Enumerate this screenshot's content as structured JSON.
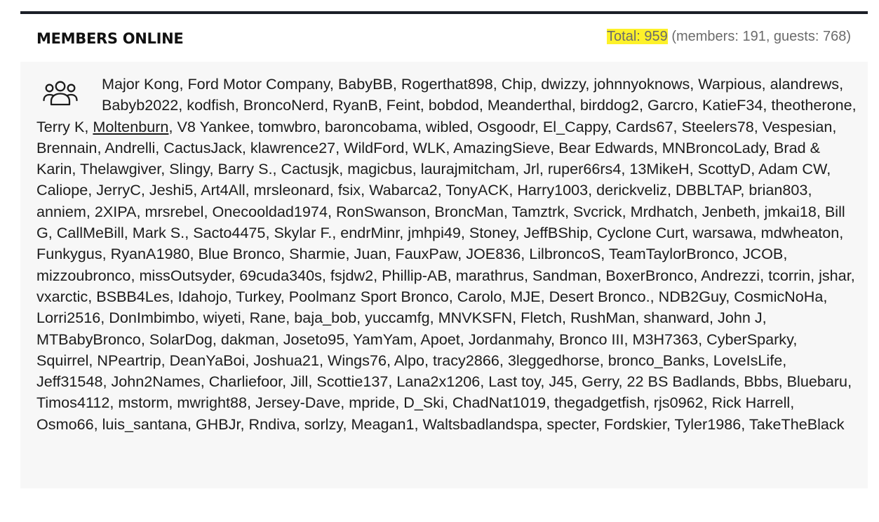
{
  "title": "MEMBERS ONLINE",
  "totals": {
    "total_label": "Total: 959",
    "breakdown": " (members: 191, guests: 768)",
    "total_count": 959,
    "members_count": 191,
    "guests_count": 768,
    "highlight_color": "#fdf12a"
  },
  "icon": "users-group-icon",
  "members": [
    "Major Kong",
    "Ford Motor Company",
    "BabyBB",
    "Rogerthat898",
    "Chip",
    "dwizzy",
    "johnnyoknows",
    "Warpious",
    "alandrews",
    "Babyb2022",
    "kodfish",
    "BroncoNerd",
    "RyanB",
    "Feint",
    "bobdod",
    "Meanderthal",
    "birddog2",
    "Garcro",
    "KatieF34",
    "theotherone",
    "Terry K",
    "Moltenburn",
    "V8 Yankee",
    "tomwbro",
    "baroncobama",
    "wibled",
    "Osgoodr",
    "El_Cappy",
    "Cards67",
    "Steelers78",
    "Vespesian",
    "Brennain",
    "Andrelli",
    "CactusJack",
    "klawrence27",
    "WildFord",
    "WLK",
    "AmazingSieve",
    "Bear Edwards",
    "MNBroncoLady",
    "Brad & Karin",
    "Thelawgiver",
    "Slingy",
    "Barry S.",
    "Cactusjk",
    "magicbus",
    "laurajmitcham",
    "Jrl",
    "ruper66rs4",
    "13MikeH",
    "ScottyD",
    "Adam CW",
    "Caliope",
    "JerryC",
    "Jeshi5",
    "Art4All",
    "mrsleonard",
    "fsix",
    "Wabarca2",
    "TonyACK",
    "Harry1003",
    "derickveliz",
    "DBBLTAP",
    "brian803",
    "anniem",
    "2XIPA",
    "mrsrebel",
    "Onecooldad1974",
    "RonSwanson",
    "BroncMan",
    "Tamztrk",
    "Svcrick",
    "Mrdhatch",
    "Jenbeth",
    "jmkai18",
    "Bill G",
    "CallMeBill",
    "Mark S.",
    "Sacto4475",
    "Skylar F.",
    "endrMinr",
    "jmhpi49",
    "Stoney",
    "JeffBShip",
    "Cyclone Curt",
    "warsawa",
    "mdwheaton",
    "Funkygus",
    "RyanA1980",
    "Blue Bronco",
    "Sharmie",
    "Juan",
    "FauxPaw",
    "JOE836",
    "LilbroncoS",
    "TeamTaylorBronco",
    "JCOB",
    "mizzoubronco",
    "missOutsyder",
    "69cuda340s",
    "fsjdw2",
    "Phillip-AB",
    "marathrus",
    "Sandman",
    "BoxerBronco",
    "Andrezzi",
    "tcorrin",
    "jshar",
    "vxarctic",
    "BSBB4Les",
    "Idahojo",
    "Turkey",
    "Poolmanz Sport Bronco",
    "Carolo",
    "MJE",
    "Desert Bronco.",
    "NDB2Guy",
    "CosmicNoHa",
    "Lorri2516",
    "DonImbimbo",
    "wiyeti",
    "Rane",
    "baja_bob",
    "yuccamfg",
    "MNVKSFN",
    "Fletch",
    "RushMan",
    "shanward",
    "John J",
    "MTBabyBronco",
    "SolarDog",
    "dakman",
    "Joseto95",
    "YamYam",
    "Apoet",
    "Jordanmahy",
    "Bronco III",
    "M3H7363",
    "CyberSparky",
    "Squirrel",
    "NPeartrip",
    "DeanYaBoi",
    "Joshua21",
    "Wings76",
    "Alpo",
    "tracy2866",
    "3leggedhorse",
    "bronco_Banks",
    "LoveIsLife",
    "Jeff31548",
    "John2Names",
    "Charliefoor",
    "Jill",
    "Scottie137",
    "Lana2x1206",
    "Last toy",
    "J45",
    "Gerry",
    "22 BS Badlands",
    "Bbbs",
    "Bluebaru",
    "Timos4112",
    "mstorm",
    "mwright88",
    "Jersey-Dave",
    "mpride",
    "D_Ski",
    "ChadNat1019",
    "thegadgetfish",
    "rjs0962",
    "Rick Harrell",
    "Osmo66",
    "luis_santana",
    "GHBJr",
    "Rndiva",
    "sorlzy",
    "Meagan1",
    "Waltsbadlandspa",
    "specter",
    "Fordskier",
    "Tyler1986",
    "TakeTheBlack"
  ],
  "underlined_member": "Moltenburn"
}
